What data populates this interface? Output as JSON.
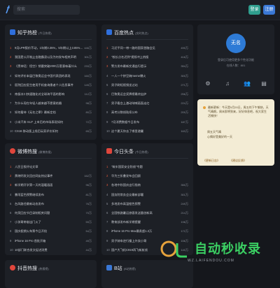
{
  "topbar": {
    "search_placeholder": "搜索",
    "login": "登录",
    "register": "注册"
  },
  "cards": {
    "zhihu": {
      "title": "知乎热榜",
      "sub": "(今日热榜)",
      "items": [
        {
          "idx": "1",
          "text": "9月LPR报价不动，1年期3.35%，5年期以上3.85%，如何解读",
          "val": "446万"
        },
        {
          "idx": "2",
          "text": "我国是公开制止金融霸凌以及为何发布相关声明",
          "val": "301万"
        },
        {
          "idx": "3",
          "text": "《黑神话：悟空》销量突破2000万套意味着什么",
          "val": "233万"
        },
        {
          "idx": "4",
          "text": "如何评价本届巴黎奥运会中国代表团的表现",
          "val": "160万"
        },
        {
          "idx": "5",
          "text": "医院回应医生使用手机查询患者个人信息事件",
          "val": "145万"
        },
        {
          "idx": "6",
          "text": "南极冰川快速融化对全球海平面的影响",
          "val": "112万"
        },
        {
          "idx": "7",
          "text": "为什么现在年轻人越来越不愿意结婚",
          "val": "98万"
        },
        {
          "idx": "8",
          "text": "如何看待《无名之辈》最新定档",
          "val": "80万"
        },
        {
          "idx": "9",
          "text": "小米汽车 SU7 上市后的市场表现如何",
          "val": "72万"
        },
        {
          "idx": "10",
          "text": "CS16 移动版上线后玩家评价如何",
          "val": "65万"
        }
      ]
    },
    "weibo": {
      "title": "微博热搜",
      "sub": "(微博热搜)",
      "items": [
        {
          "idx": "1",
          "text": "人民日报评论文章",
          "val": ""
        },
        {
          "idx": "2",
          "text": "黄晓明发文回应网友热议事件",
          "val": "162万"
        },
        {
          "idx": "3",
          "text": "新学期开学第一天的温暖画面",
          "val": "96万"
        },
        {
          "idx": "4",
          "text": "暴雨蓝色预警继续发布",
          "val": "81万"
        },
        {
          "idx": "5",
          "text": "台风路径最新动态发布",
          "val": "76万"
        },
        {
          "idx": "6",
          "text": "何炅回应节目录制相关问题",
          "val": "70万"
        },
        {
          "idx": "7",
          "text": "小孩哥带崽出门火了",
          "val": "59万"
        },
        {
          "idx": "8",
          "text": "国庆假期火车票今日开抢",
          "val": "54万"
        },
        {
          "idx": "9",
          "text": "iPhone 16 Pro 首批开箱",
          "val": "49万"
        },
        {
          "idx": "10",
          "text": "10部门联合发文促进消费",
          "val": "44万"
        },
        {
          "idx": "11",
          "text": "网络热梗盘点出炉",
          "val": "38万"
        }
      ]
    },
    "baidu": {
      "title": "百度热点",
      "sub": "(实时热点)",
      "items": [
        {
          "idx": "1",
          "text": "习近平同一带一路的国家首脑会见",
          "val": "490万"
        },
        {
          "idx": "2",
          "text": "\"校长点名迟到\"视频冲上热搜",
          "val": "418万"
        },
        {
          "idx": "3",
          "text": "警方发布最新交通出行提示",
          "val": "354万"
        },
        {
          "idx": "4",
          "text": "一人一个拼豆碗meme爆火",
          "val": "300万"
        },
        {
          "idx": "5",
          "text": "男子刷短视频坐过站",
          "val": "271万"
        },
        {
          "idx": "6",
          "text": "巴黎奥运会奖牌榜最终出炉",
          "val": "256万"
        },
        {
          "idx": "7",
          "text": "男子看台上激动呐喊画面走红",
          "val": "224万"
        },
        {
          "idx": "8",
          "text": "高考分数线陆续公布",
          "val": "200万"
        },
        {
          "idx": "9",
          "text": "7月消费数据今日发布",
          "val": "187万"
        },
        {
          "idx": "10",
          "text": "这个夏天你去了哪里避暑",
          "val": "163万"
        }
      ]
    },
    "toutiao": {
      "title": "今日头条",
      "sub": "(今日热榜)",
      "items": [
        {
          "idx": "1",
          "text": "\"筑牢国家安全防线\"专题",
          "val": ""
        },
        {
          "idx": "2",
          "text": "华为三折叠发布会回顾",
          "val": ""
        },
        {
          "idx": "3",
          "text": "各地中秋国庆出行指南",
          "val": "350万"
        },
        {
          "idx": "4",
          "text": "国务院常务会议最新部署",
          "val": "301万"
        },
        {
          "idx": "5",
          "text": "多地发布高温橙色预警",
          "val": "249万"
        },
        {
          "idx": "6",
          "text": "全国铁路暑运旅客发送量创新高",
          "val": "214万"
        },
        {
          "idx": "7",
          "text": "教育部发布新学期提醒",
          "val": "198万"
        },
        {
          "idx": "8",
          "text": "iPhone 16 Pro Max最贵超1.3万",
          "val": "172万"
        },
        {
          "idx": "9",
          "text": "男子骑车逆行撞上外卖小哥",
          "val": "156万"
        },
        {
          "idx": "10",
          "text": "国产大飞机C919再飞新航线",
          "val": "140万"
        },
        {
          "idx": "11",
          "text": "国际油价大幅下跌",
          "val": "128万"
        }
      ]
    },
    "douyin": {
      "title": "抖音热搜",
      "sub": "(热搜榜)"
    },
    "bilibili": {
      "title": "B站",
      "sub": "(B站热榜)"
    }
  },
  "profile": {
    "avatar": "无名",
    "welcome": "登录后可使用更多个性化功能",
    "online": "在线人数：801"
  },
  "notice": {
    "body": "最新更新：今天是9月20日，周五的下午愉快，天气晴朗，周末即将到来，好好休息吧，祝大家生活愉快！",
    "line1": "周五天气晴",
    "line2": "心情好是美好的一天",
    "link1": "《更新日志》",
    "link2": "《建议反馈》"
  },
  "watermark": {
    "big": "自动秒收录",
    "small": "WZ.LAIFENDOU.COM"
  }
}
